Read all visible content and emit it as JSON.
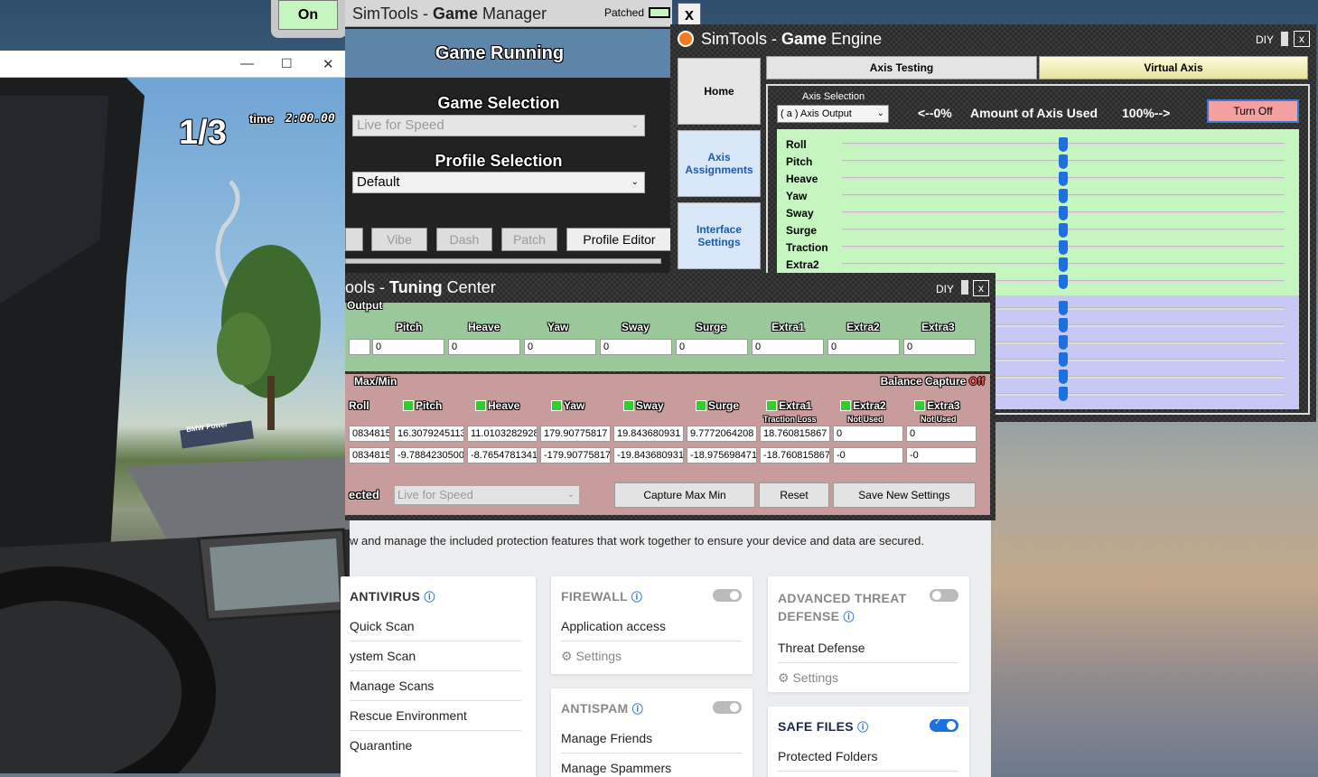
{
  "game": {
    "lap": "1/3",
    "time_label": "time",
    "time_value": "2:00.00",
    "billboard": "BMW Power"
  },
  "game_manager": {
    "on_button": "On",
    "title_prefix": "SimTools - ",
    "title_bold": "Game",
    "title_suffix": " Manager",
    "patched_label": "Patched",
    "close": "x",
    "game_running": "Game Running",
    "game_selection_label": "Game Selection",
    "game_selection_value": "Live for Speed",
    "profile_selection_label": "Profile Selection",
    "profile_selection_value": "Default",
    "buttons": [
      "Vibe",
      "Dash",
      "Patch"
    ],
    "profile_editor": "Profile Editor"
  },
  "game_engine": {
    "title_prefix": "SimTools - ",
    "title_bold": "Game",
    "title_suffix": " Engine",
    "diy": "DIY",
    "close": "x",
    "tabs": [
      "Axis Testing",
      "Virtual Axis"
    ],
    "side_buttons": [
      "Home",
      "Axis Assignments",
      "Interface Settings"
    ],
    "axis_selection_label": "Axis Selection",
    "axis_selection_value": "( a ) Axis Output",
    "pct_min": "<--0%",
    "amount_label": "Amount of Axis Used",
    "pct_max": "100%-->",
    "turn_off": "Turn Off",
    "axes": [
      "Roll",
      "Pitch",
      "Heave",
      "Yaw",
      "Sway",
      "Surge",
      "Traction",
      "Extra2"
    ]
  },
  "tuning_center": {
    "title_prefix": "ools - ",
    "title_bold": "Tuning",
    "title_suffix": " Center",
    "diy": "DIY",
    "close": "x",
    "output_label": "Output",
    "output_axes": [
      "Pitch",
      "Heave",
      "Yaw",
      "Sway",
      "Surge",
      "Extra1",
      "Extra2",
      "Extra3"
    ],
    "output_values": [
      "",
      "0",
      "0",
      "0",
      "0",
      "0",
      "0",
      "0",
      "0"
    ],
    "maxmin_label": "Max/Min",
    "balance_label": "Balance Capture",
    "balance_state": "Off",
    "maxmin_axes": [
      "Roll",
      "Pitch",
      "Heave",
      "Yaw",
      "Sway",
      "Surge",
      "Extra1",
      "Extra2",
      "Extra3"
    ],
    "sublabels": [
      "Traction Loss",
      "Not Used",
      "Not Used"
    ],
    "max_values": [
      "0834815",
      "16.3079245113",
      "11.0103282928",
      "179.90775817",
      "19.843680931",
      "9.7772064208",
      "18.760815867",
      "0",
      "0"
    ],
    "min_values": [
      "0834815",
      "-9.7884230500",
      "-8.7654781341",
      "-179.90775817",
      "-19.843680931",
      "-18.975698471",
      "-18.760815867",
      "-0",
      "-0"
    ],
    "selected_label": "ected",
    "game_value": "Live for Speed",
    "capture_btn": "Capture Max Min",
    "reset_btn": "Reset",
    "save_btn": "Save New Settings"
  },
  "antivirus": {
    "description": "w and manage the included protection features that work together to ensure your device and data are secured.",
    "antivirus_title": "ANTIVIRUS",
    "antivirus_items": [
      "Quick Scan",
      "ystem Scan",
      "Manage Scans",
      "Rescue Environment",
      "Quarantine"
    ],
    "firewall_title": "FIREWALL",
    "firewall_items": [
      "Application access"
    ],
    "firewall_settings": "Settings",
    "antispam_title": "ANTISPAM",
    "antispam_items": [
      "Manage Friends",
      "Manage Spammers"
    ],
    "atd_title_1": "ADVANCED THREAT",
    "atd_title_2": "DEFENSE",
    "atd_items": [
      "Threat Defense"
    ],
    "atd_settings": "Settings",
    "safe_files_title": "SAFE FILES",
    "safe_files_items": [
      "Protected Folders"
    ]
  },
  "colors": {
    "game_manager_header": "#5e84a8",
    "engine_green": "#c6f6c0",
    "engine_purple": "#c8c8f4",
    "slider_thumb": "#1e6fe0",
    "tuning_green": "#9bc89b",
    "tuning_red": "#c79c9a",
    "toggle_on": "#1e6fe0",
    "turn_off_btn": "#f4a0a0"
  }
}
